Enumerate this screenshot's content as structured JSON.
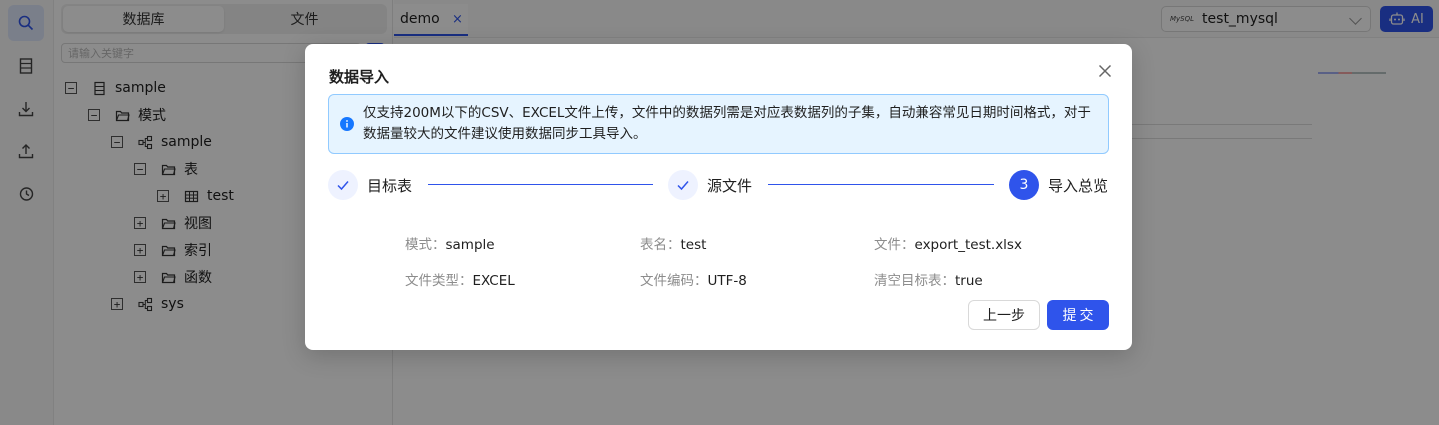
{
  "sidebar": {
    "icons": [
      "search-icon",
      "database-icon",
      "download-icon",
      "upload-icon",
      "history-icon"
    ]
  },
  "left_panel": {
    "segments": [
      {
        "label": "数据库",
        "active": true
      },
      {
        "label": "文件",
        "active": false
      }
    ],
    "search_placeholder": "请输入关键字",
    "tree": [
      {
        "label": "sample",
        "toggle": "−",
        "icon": "database-icon",
        "level": 0
      },
      {
        "label": "模式",
        "toggle": "−",
        "icon": "folder-icon",
        "level": 1
      },
      {
        "label": "sample",
        "toggle": "−",
        "icon": "schema-icon",
        "level": 2
      },
      {
        "label": "表",
        "toggle": "−",
        "icon": "folder-icon",
        "level": 3
      },
      {
        "label": "test",
        "toggle": "+",
        "icon": "table-icon",
        "level": 4
      },
      {
        "label": "视图",
        "toggle": "+",
        "icon": "folder-icon",
        "level": 3
      },
      {
        "label": "索引",
        "toggle": "+",
        "icon": "folder-icon",
        "level": 3
      },
      {
        "label": "函数",
        "toggle": "+",
        "icon": "folder-icon",
        "level": 3
      },
      {
        "label": "sys",
        "toggle": "+",
        "icon": "schema-icon",
        "level": 2
      }
    ]
  },
  "topbar": {
    "tab_label": "demo",
    "tab_close": "×",
    "connection_badge": "MySQL",
    "connection": "test_mysql",
    "ai_label": "AI"
  },
  "modal": {
    "title": "数据导入",
    "notice": "仅支持200M以下的CSV、EXCEL文件上传，文件中的数据列需是对应表数据列的子集，自动兼容常见日期时间格式，对于数据量较大的文件建议使用数据同步工具导入。",
    "steps": [
      {
        "label": "目标表",
        "status": "done"
      },
      {
        "label": "源文件",
        "status": "done"
      },
      {
        "label": "导入总览",
        "status": "current",
        "number": "3"
      }
    ],
    "summary": [
      {
        "key": "模式：",
        "value": "sample"
      },
      {
        "key": "表名：",
        "value": "test"
      },
      {
        "key": "文件：",
        "value": "export_test.xlsx"
      },
      {
        "key": "文件类型：",
        "value": "EXCEL"
      },
      {
        "key": "文件编码：",
        "value": "UTF-8"
      },
      {
        "key": "清空目标表：",
        "value": "true"
      }
    ],
    "prev_label": "上一步",
    "submit_label": "提交"
  },
  "colors": {
    "primary": "#2f54eb",
    "alert_bg": "#e6f4ff",
    "alert_border": "#91caff",
    "mask": "rgba(0,0,0,0.45)"
  }
}
